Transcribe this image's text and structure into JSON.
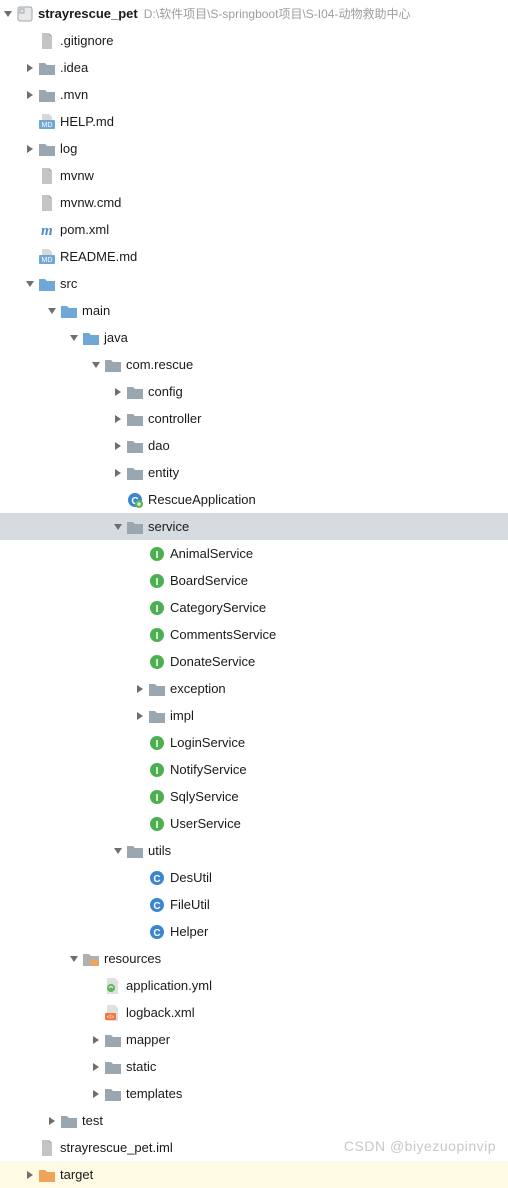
{
  "watermark": "CSDN @biyezuopinvip",
  "root": {
    "name": "strayrescue_pet",
    "hint": "D:\\软件项目\\S-springboot项目\\S-I04-动物救助中心"
  },
  "items": [
    {
      "depth": 0,
      "arrow": "down",
      "icon": "module",
      "label": "strayrescue_pet",
      "bold": true,
      "hint": "D:\\软件项目\\S-springboot项目\\S-I04-动物救助中心",
      "int": true,
      "name": "project-root"
    },
    {
      "depth": 1,
      "arrow": "",
      "icon": "file",
      "label": ".gitignore",
      "int": true,
      "name": "file-gitignore"
    },
    {
      "depth": 1,
      "arrow": "right",
      "icon": "folder",
      "label": ".idea",
      "int": true,
      "name": "folder-idea"
    },
    {
      "depth": 1,
      "arrow": "right",
      "icon": "folder",
      "label": ".mvn",
      "int": true,
      "name": "folder-mvn"
    },
    {
      "depth": 1,
      "arrow": "",
      "icon": "md",
      "label": "HELP.md",
      "int": true,
      "name": "file-help-md"
    },
    {
      "depth": 1,
      "arrow": "right",
      "icon": "folder",
      "label": "log",
      "int": true,
      "name": "folder-log"
    },
    {
      "depth": 1,
      "arrow": "",
      "icon": "file",
      "label": "mvnw",
      "int": true,
      "name": "file-mvnw"
    },
    {
      "depth": 1,
      "arrow": "",
      "icon": "file",
      "label": "mvnw.cmd",
      "int": true,
      "name": "file-mvnw-cmd"
    },
    {
      "depth": 1,
      "arrow": "",
      "icon": "m",
      "label": "pom.xml",
      "int": true,
      "name": "file-pom-xml"
    },
    {
      "depth": 1,
      "arrow": "",
      "icon": "md",
      "label": "README.md",
      "int": true,
      "name": "file-readme-md"
    },
    {
      "depth": 1,
      "arrow": "down",
      "icon": "folder-blue",
      "label": "src",
      "int": true,
      "name": "folder-src"
    },
    {
      "depth": 2,
      "arrow": "down",
      "icon": "folder-blue",
      "label": "main",
      "int": true,
      "name": "folder-main"
    },
    {
      "depth": 3,
      "arrow": "down",
      "icon": "folder-blue",
      "label": "java",
      "int": true,
      "name": "folder-java"
    },
    {
      "depth": 4,
      "arrow": "down",
      "icon": "folder",
      "label": "com.rescue",
      "int": true,
      "name": "package-com-rescue"
    },
    {
      "depth": 5,
      "arrow": "right",
      "icon": "folder",
      "label": "config",
      "int": true,
      "name": "package-config"
    },
    {
      "depth": 5,
      "arrow": "right",
      "icon": "folder",
      "label": "controller",
      "int": true,
      "name": "package-controller"
    },
    {
      "depth": 5,
      "arrow": "right",
      "icon": "folder",
      "label": "dao",
      "int": true,
      "name": "package-dao"
    },
    {
      "depth": 5,
      "arrow": "right",
      "icon": "folder",
      "label": "entity",
      "int": true,
      "name": "package-entity"
    },
    {
      "depth": 5,
      "arrow": "",
      "icon": "class-green",
      "label": "RescueApplication",
      "int": true,
      "name": "class-rescue-application"
    },
    {
      "depth": 5,
      "arrow": "down",
      "icon": "folder",
      "label": "service",
      "int": true,
      "name": "package-service",
      "highlight": true
    },
    {
      "depth": 6,
      "arrow": "",
      "icon": "interface",
      "label": "AnimalService",
      "int": true,
      "name": "interface-animal-service"
    },
    {
      "depth": 6,
      "arrow": "",
      "icon": "interface",
      "label": "BoardService",
      "int": true,
      "name": "interface-board-service"
    },
    {
      "depth": 6,
      "arrow": "",
      "icon": "interface",
      "label": "CategoryService",
      "int": true,
      "name": "interface-category-service"
    },
    {
      "depth": 6,
      "arrow": "",
      "icon": "interface",
      "label": "CommentsService",
      "int": true,
      "name": "interface-comments-service"
    },
    {
      "depth": 6,
      "arrow": "",
      "icon": "interface",
      "label": "DonateService",
      "int": true,
      "name": "interface-donate-service"
    },
    {
      "depth": 6,
      "arrow": "right",
      "icon": "folder",
      "label": "exception",
      "int": true,
      "name": "package-exception"
    },
    {
      "depth": 6,
      "arrow": "right",
      "icon": "folder",
      "label": "impl",
      "int": true,
      "name": "package-impl"
    },
    {
      "depth": 6,
      "arrow": "",
      "icon": "interface",
      "label": "LoginService",
      "int": true,
      "name": "interface-login-service"
    },
    {
      "depth": 6,
      "arrow": "",
      "icon": "interface",
      "label": "NotifyService",
      "int": true,
      "name": "interface-notify-service"
    },
    {
      "depth": 6,
      "arrow": "",
      "icon": "interface",
      "label": "SqlyService",
      "int": true,
      "name": "interface-sqly-service"
    },
    {
      "depth": 6,
      "arrow": "",
      "icon": "interface",
      "label": "UserService",
      "int": true,
      "name": "interface-user-service"
    },
    {
      "depth": 5,
      "arrow": "down",
      "icon": "folder",
      "label": "utils",
      "int": true,
      "name": "package-utils"
    },
    {
      "depth": 6,
      "arrow": "",
      "icon": "class",
      "label": "DesUtil",
      "int": true,
      "name": "class-des-util"
    },
    {
      "depth": 6,
      "arrow": "",
      "icon": "class",
      "label": "FileUtil",
      "int": true,
      "name": "class-file-util"
    },
    {
      "depth": 6,
      "arrow": "",
      "icon": "class",
      "label": "Helper",
      "int": true,
      "name": "class-helper"
    },
    {
      "depth": 3,
      "arrow": "down",
      "icon": "folder-res",
      "label": "resources",
      "int": true,
      "name": "folder-resources"
    },
    {
      "depth": 4,
      "arrow": "",
      "icon": "yml",
      "label": "application.yml",
      "int": true,
      "name": "file-application-yml"
    },
    {
      "depth": 4,
      "arrow": "",
      "icon": "xml",
      "label": "logback.xml",
      "int": true,
      "name": "file-logback-xml"
    },
    {
      "depth": 4,
      "arrow": "right",
      "icon": "folder",
      "label": "mapper",
      "int": true,
      "name": "folder-mapper"
    },
    {
      "depth": 4,
      "arrow": "right",
      "icon": "folder",
      "label": "static",
      "int": true,
      "name": "folder-static"
    },
    {
      "depth": 4,
      "arrow": "right",
      "icon": "folder",
      "label": "templates",
      "int": true,
      "name": "folder-templates"
    },
    {
      "depth": 2,
      "arrow": "right",
      "icon": "folder",
      "label": "test",
      "int": true,
      "name": "folder-test"
    },
    {
      "depth": 1,
      "arrow": "",
      "icon": "file",
      "label": "strayrescue_pet.iml",
      "int": true,
      "name": "file-iml"
    },
    {
      "depth": 1,
      "arrow": "right",
      "icon": "folder-orange",
      "label": "target",
      "int": true,
      "name": "folder-target",
      "targetHighlight": true
    }
  ]
}
